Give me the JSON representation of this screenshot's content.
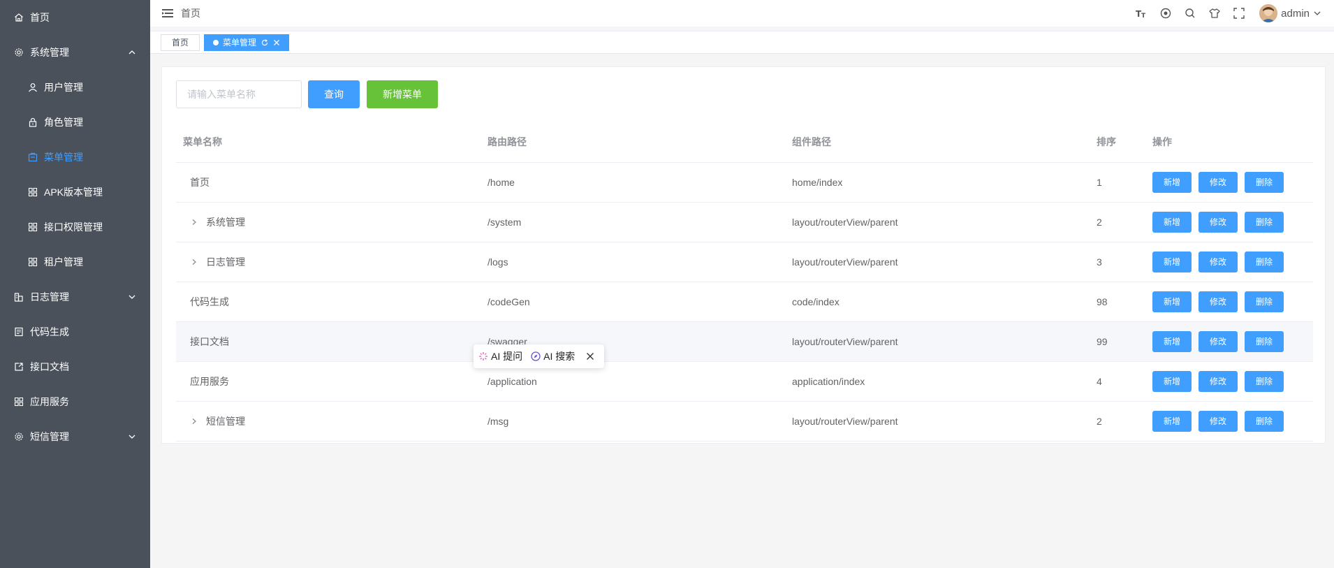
{
  "sidebar": {
    "items": [
      {
        "label": "首页",
        "icon": "home-icon",
        "sub": false,
        "arrow": ""
      },
      {
        "label": "系统管理",
        "icon": "gear-icon",
        "sub": false,
        "arrow": "up"
      },
      {
        "label": "用户管理",
        "icon": "user-icon",
        "sub": true,
        "arrow": ""
      },
      {
        "label": "角色管理",
        "icon": "lock-icon",
        "sub": true,
        "arrow": ""
      },
      {
        "label": "菜单管理",
        "icon": "menu-icon",
        "sub": true,
        "arrow": "",
        "active": true
      },
      {
        "label": "APK版本管理",
        "icon": "grid-icon",
        "sub": true,
        "arrow": ""
      },
      {
        "label": "接口权限管理",
        "icon": "grid-icon",
        "sub": true,
        "arrow": ""
      },
      {
        "label": "租户管理",
        "icon": "grid-icon",
        "sub": true,
        "arrow": ""
      },
      {
        "label": "日志管理",
        "icon": "chart-icon",
        "sub": false,
        "arrow": "down"
      },
      {
        "label": "代码生成",
        "icon": "doc-icon",
        "sub": false,
        "arrow": ""
      },
      {
        "label": "接口文档",
        "icon": "share-icon",
        "sub": false,
        "arrow": ""
      },
      {
        "label": "应用服务",
        "icon": "grid-icon",
        "sub": false,
        "arrow": ""
      },
      {
        "label": "短信管理",
        "icon": "gear-icon",
        "sub": false,
        "arrow": "down"
      }
    ]
  },
  "header": {
    "breadcrumb": "首页",
    "username": "admin"
  },
  "tags": {
    "home": "首页",
    "active": "菜单管理"
  },
  "toolbar": {
    "search_placeholder": "请输入菜单名称",
    "query_label": "查询",
    "add_label": "新增菜单"
  },
  "table": {
    "headers": [
      "菜单名称",
      "路由路径",
      "组件路径",
      "排序",
      "操作"
    ],
    "rows": [
      {
        "name": "首页",
        "path": "/home",
        "component": "home/index",
        "sort": "1",
        "expandable": false
      },
      {
        "name": "系统管理",
        "path": "/system",
        "component": "layout/routerView/parent",
        "sort": "2",
        "expandable": true
      },
      {
        "name": "日志管理",
        "path": "/logs",
        "component": "layout/routerView/parent",
        "sort": "3",
        "expandable": true
      },
      {
        "name": "代码生成",
        "path": "/codeGen",
        "component": "code/index",
        "sort": "98",
        "expandable": false
      },
      {
        "name": "接口文档",
        "path": "/swagger",
        "component": "layout/routerView/parent",
        "sort": "99",
        "expandable": false,
        "highlight": true
      },
      {
        "name": "应用服务",
        "path": "/application",
        "component": "application/index",
        "sort": "4",
        "expandable": false
      },
      {
        "name": "短信管理",
        "path": "/msg",
        "component": "layout/routerView/parent",
        "sort": "2",
        "expandable": true
      }
    ],
    "ops": {
      "add": "新增",
      "edit": "修改",
      "delete": "删除"
    }
  },
  "ai_popup": {
    "ask_label": "AI 提问",
    "search_label": "AI 搜索"
  },
  "colors": {
    "sidebar_bg": "#4a515a",
    "primary": "#409eff",
    "success": "#67c23a"
  }
}
